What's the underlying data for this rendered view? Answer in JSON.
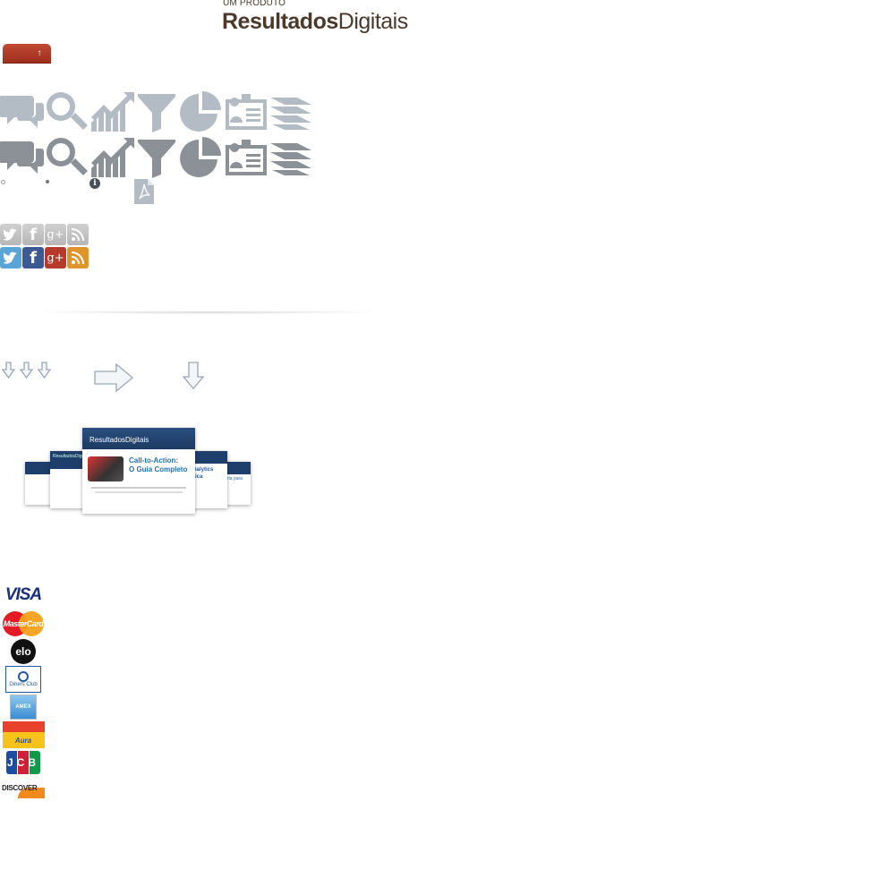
{
  "logo": {
    "sub": "UM PRODUTO",
    "name_bold": "Resultados",
    "name_light": "Digitais"
  },
  "up_button": {
    "label": "↑"
  },
  "icon_rows": [
    [
      "chat-icon",
      "search-icon",
      "growth-chart-icon",
      "funnel-icon",
      "pie-chart-icon",
      "id-card-icon",
      "layers-icon"
    ],
    [
      "chat-icon",
      "search-icon",
      "growth-chart-icon",
      "funnel-icon",
      "pie-chart-icon",
      "id-card-icon",
      "layers-icon"
    ]
  ],
  "info_glyph": "i",
  "social": [
    {
      "name": "twitter",
      "glyph": "t"
    },
    {
      "name": "facebook",
      "glyph": "f"
    },
    {
      "name": "google-plus",
      "glyph": "g+"
    },
    {
      "name": "rss",
      "glyph": "rss"
    }
  ],
  "social_colors": {
    "twitter": "#5aa5d8",
    "facebook": "#3b5a93",
    "google-plus": "#b63a2c",
    "rss": "#e0952a",
    "inactive": "#c4c4c4"
  },
  "ebook": {
    "center_brand": "ResultadosDigitais",
    "center_title_1": "Call-to-Action:",
    "center_title_2": "O Guia Completo",
    "side_left_brand": "ResultadosDigitais",
    "side_right_text_1": "nalytics",
    "side_right_text_2": "tica",
    "far_right_text": "ria para"
  },
  "payment_cards": [
    {
      "name": "visa",
      "label": "VISA"
    },
    {
      "name": "mastercard",
      "label": "MasterCard"
    },
    {
      "name": "elo",
      "label": "elo"
    },
    {
      "name": "diners",
      "label": "Diners Club"
    },
    {
      "name": "amex",
      "label": "AMEX"
    },
    {
      "name": "aura",
      "label": "Aura"
    },
    {
      "name": "jcb",
      "label": "JCB"
    },
    {
      "name": "discover",
      "label": "DISCOVER"
    }
  ]
}
